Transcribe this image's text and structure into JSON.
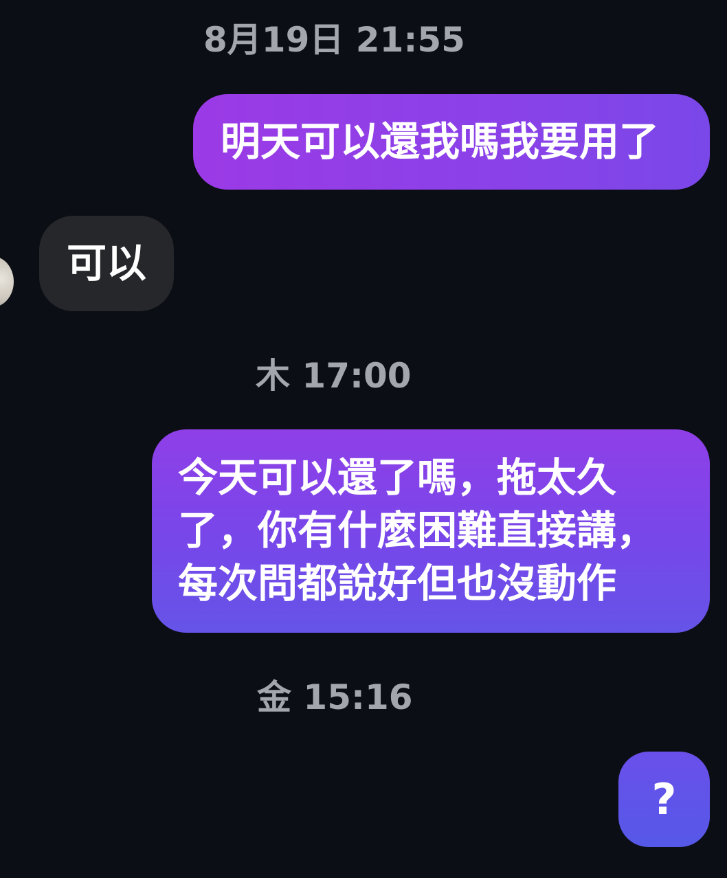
{
  "conversation": {
    "messages": [
      {
        "type": "timestamp",
        "text": "8月19日 21:55"
      },
      {
        "type": "outgoing",
        "text": "明天可以還我嗎我要用了"
      },
      {
        "type": "incoming",
        "text": "可以"
      },
      {
        "type": "timestamp",
        "text": "木 17:00"
      },
      {
        "type": "outgoing",
        "lines": [
          "今天可以還了嗎，拖太久",
          "了，你有什麼困難直接講，",
          "每次問都說好但也沒動作"
        ]
      },
      {
        "type": "timestamp",
        "text": "金 15:16"
      },
      {
        "type": "outgoing",
        "text": "?"
      }
    ]
  },
  "colors": {
    "background": "#0b0e14",
    "outgoing_bubble_top": "#8f3fe8",
    "outgoing_bubble_bottom": "#6554e8",
    "incoming_bubble": "#25272b",
    "timestamp_text": "#a3a6ad"
  },
  "icons": {
    "avatar": "avatar-photo"
  }
}
